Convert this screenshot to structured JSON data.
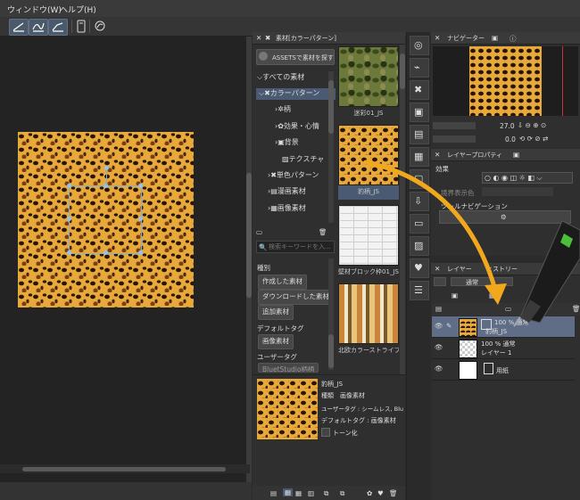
{
  "menu": {
    "window": "ウィンドウ(W)",
    "help": "ヘルプ(H)"
  },
  "materials": {
    "panel_title": "素材[カラーパターン]",
    "assets_button": "ASSETSで素材を探す",
    "tree": [
      {
        "label": "すべての素材",
        "indent": 0,
        "arrow": "⌵"
      },
      {
        "label": "カラーパターン",
        "indent": 1,
        "arrow": "⌵"
      },
      {
        "label": "柄",
        "indent": 2,
        "arrow": "›"
      },
      {
        "label": "効果・心情",
        "indent": 2,
        "arrow": "›"
      },
      {
        "label": "背景",
        "indent": 2,
        "arrow": "›"
      },
      {
        "label": "テクスチャ",
        "indent": 2,
        "arrow": ""
      },
      {
        "label": "単色パターン",
        "indent": 1,
        "arrow": "›"
      },
      {
        "label": "漫画素材",
        "indent": 1,
        "arrow": "›"
      },
      {
        "label": "画像素材",
        "indent": 1,
        "arrow": "›"
      }
    ],
    "search_placeholder": "検索キーワードを入...",
    "type_label": "種別",
    "type_buttons": [
      "作成した素材",
      "ダウンロードした素材",
      "追加素材"
    ],
    "default_tag_label": "デフォルトタグ",
    "default_tag_button": "画像素材",
    "user_tag_label": "ユーザータグ",
    "user_tag_button": "BluetStudio柄柄",
    "thumbnails": [
      "迷彩01_JS",
      "豹柄_JS",
      "壁材ブロック枠01_JS",
      "北欧カラーストライプ01"
    ],
    "detail": {
      "name": "豹柄_JS",
      "type": "種類　画像素材",
      "user_tag": "ユーザータグ : シームレス, BluetStudi",
      "default_tag": "デフォルトタグ : 画像素材",
      "tone": "トーン化"
    }
  },
  "navigator": {
    "title": "ナビゲーター",
    "zoom": "27.0",
    "rotate": "0.0"
  },
  "layer_property": {
    "title": "レイヤープロパティ",
    "effect": "効果",
    "color_label": "境界表示色",
    "navigation_label": "ツールナビゲーション"
  },
  "layers": {
    "tab_layer": "レイヤー",
    "tab_history": "ヒストリー",
    "blend_mode": "通常",
    "rows": [
      {
        "mode": "100 % 通常",
        "name": "豹柄_JS",
        "selected": true
      },
      {
        "mode": "100 % 通常",
        "name": "レイヤー 1",
        "selected": false
      },
      {
        "mode": "",
        "name": "用紙",
        "selected": false
      }
    ]
  },
  "colors": {
    "accent_arrow": "#f2a81d",
    "selected_row": "#5f6e86",
    "panel_bg": "#2f2f2f"
  }
}
